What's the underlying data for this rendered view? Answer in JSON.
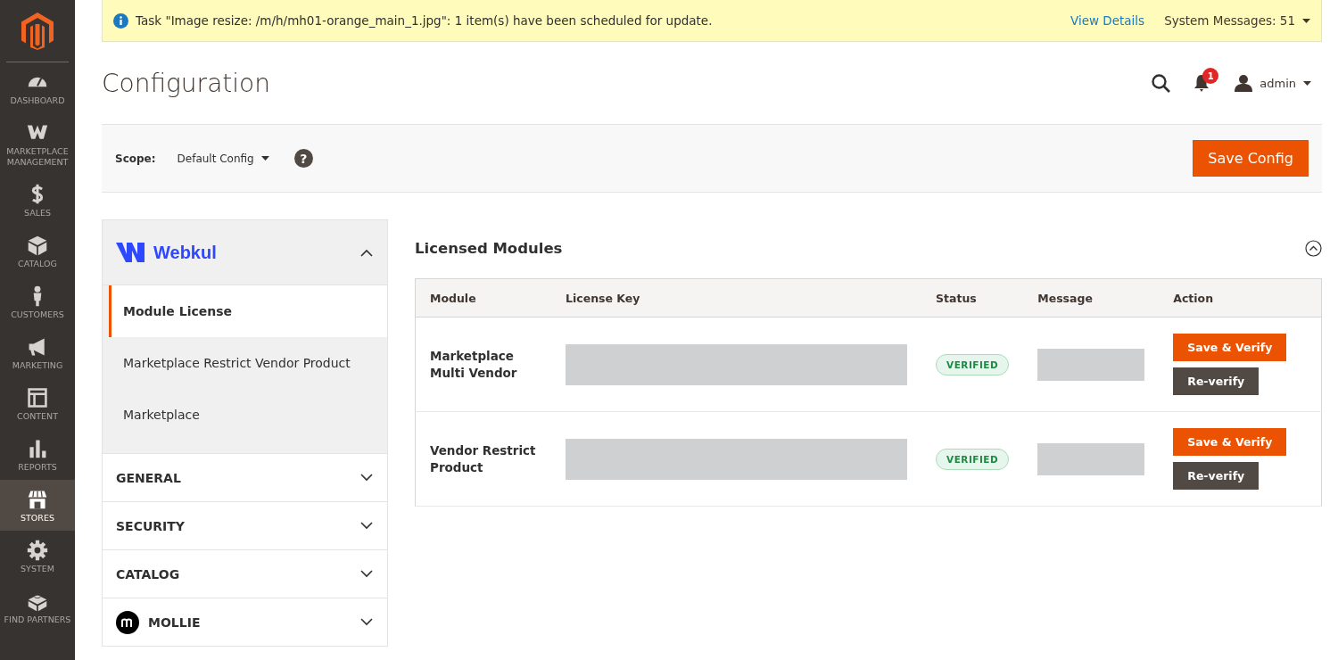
{
  "sidebar": {
    "items": [
      {
        "label": "DASHBOARD",
        "selected": false
      },
      {
        "label": "MARKETPLACE MANAGEMENT",
        "selected": false
      },
      {
        "label": "SALES",
        "selected": false
      },
      {
        "label": "CATALOG",
        "selected": false
      },
      {
        "label": "CUSTOMERS",
        "selected": false
      },
      {
        "label": "MARKETING",
        "selected": false
      },
      {
        "label": "CONTENT",
        "selected": false
      },
      {
        "label": "REPORTS",
        "selected": false
      },
      {
        "label": "STORES",
        "selected": true
      },
      {
        "label": "SYSTEM",
        "selected": false
      },
      {
        "label": "FIND PARTNERS",
        "selected": false
      }
    ]
  },
  "notice": {
    "message": "Task \"Image resize: /m/h/mh01-orange_main_1.jpg\": 1 item(s) have been scheduled for update.",
    "link": "View Details",
    "system_messages": "System Messages: 51"
  },
  "header": {
    "title": "Configuration",
    "notifications_count": "1",
    "user": "admin"
  },
  "scope": {
    "label": "Scope:",
    "value": "Default Config",
    "help": "?",
    "save_button": "Save Config"
  },
  "config_nav": {
    "sections": [
      {
        "kind": "brand",
        "label": "Webkul",
        "expanded": true,
        "children": [
          {
            "label": "Module License",
            "selected": true
          },
          {
            "label": "Marketplace Restrict Vendor Product",
            "selected": false
          },
          {
            "label": "Marketplace",
            "selected": false
          }
        ]
      },
      {
        "kind": "plain",
        "label": "GENERAL",
        "expanded": false
      },
      {
        "kind": "plain",
        "label": "SECURITY",
        "expanded": false
      },
      {
        "kind": "plain",
        "label": "CATALOG",
        "expanded": false
      },
      {
        "kind": "logo",
        "label": "MOLLIE",
        "expanded": false
      }
    ]
  },
  "licensed_modules": {
    "title": "Licensed Modules",
    "expanded": true,
    "columns": [
      "Module",
      "License Key",
      "Status",
      "Message",
      "Action"
    ],
    "rows": [
      {
        "module": "Marketplace Multi Vendor",
        "status": "VERIFIED",
        "save": "Save & Verify",
        "reverify": "Re-verify"
      },
      {
        "module": "Vendor Restrict Product",
        "status": "VERIFIED",
        "save": "Save & Verify",
        "reverify": "Re-verify"
      }
    ]
  }
}
